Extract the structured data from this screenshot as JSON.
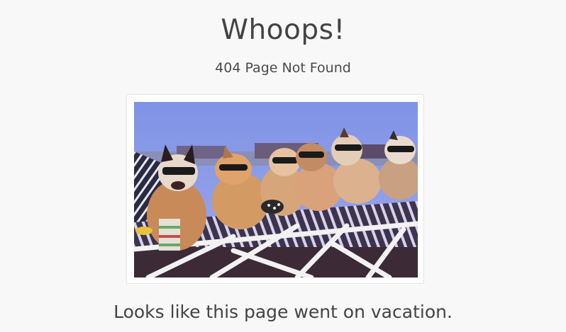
{
  "page": {
    "heading": "Whoops!",
    "subheading": "404 Page Not Found",
    "message": "Looks like this page went on vacation."
  },
  "image": {
    "depicts": "dogs-sunbathing-photo"
  },
  "colors": {
    "background": "#f8f8f8",
    "text": "#444444",
    "frame": "#ffffff"
  }
}
